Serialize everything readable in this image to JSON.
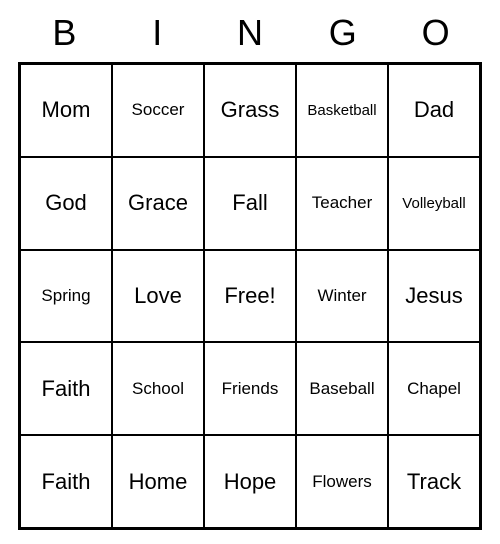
{
  "header": [
    "B",
    "I",
    "N",
    "G",
    "O"
  ],
  "grid": [
    [
      {
        "label": "Mom",
        "size": "normal"
      },
      {
        "label": "Soccer",
        "size": "small"
      },
      {
        "label": "Grass",
        "size": "normal"
      },
      {
        "label": "Basketball",
        "size": "xsmall"
      },
      {
        "label": "Dad",
        "size": "normal"
      }
    ],
    [
      {
        "label": "God",
        "size": "normal"
      },
      {
        "label": "Grace",
        "size": "normal"
      },
      {
        "label": "Fall",
        "size": "normal"
      },
      {
        "label": "Teacher",
        "size": "small"
      },
      {
        "label": "Volleyball",
        "size": "xsmall"
      }
    ],
    [
      {
        "label": "Spring",
        "size": "small"
      },
      {
        "label": "Love",
        "size": "normal"
      },
      {
        "label": "Free!",
        "size": "normal"
      },
      {
        "label": "Winter",
        "size": "small"
      },
      {
        "label": "Jesus",
        "size": "normal"
      }
    ],
    [
      {
        "label": "Faith",
        "size": "normal"
      },
      {
        "label": "School",
        "size": "small"
      },
      {
        "label": "Friends",
        "size": "small"
      },
      {
        "label": "Baseball",
        "size": "small"
      },
      {
        "label": "Chapel",
        "size": "small"
      }
    ],
    [
      {
        "label": "Faith",
        "size": "normal"
      },
      {
        "label": "Home",
        "size": "normal"
      },
      {
        "label": "Hope",
        "size": "normal"
      },
      {
        "label": "Flowers",
        "size": "small"
      },
      {
        "label": "Track",
        "size": "normal"
      }
    ]
  ]
}
